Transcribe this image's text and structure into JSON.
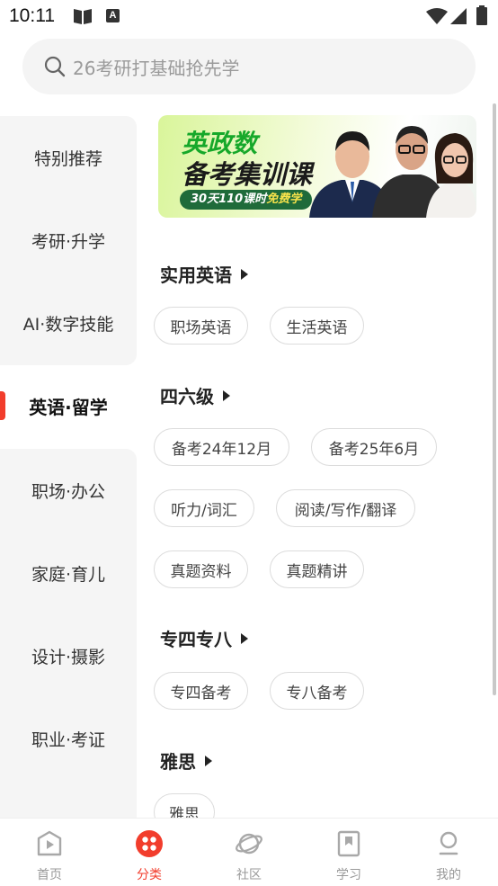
{
  "status_bar": {
    "time": "10:11",
    "icons": [
      "book-icon",
      "a-icon",
      "wifi-icon",
      "signal-icon",
      "battery-icon"
    ]
  },
  "search": {
    "placeholder": "26考研打基础抢先学"
  },
  "sidebar": {
    "items": [
      {
        "label": "特别推荐"
      },
      {
        "label": "考研·升学"
      },
      {
        "label": "AI·数字技能"
      },
      {
        "label": "英语·留学",
        "active": true
      },
      {
        "label": "职场·办公"
      },
      {
        "label": "家庭·育儿"
      },
      {
        "label": "设计·摄影"
      },
      {
        "label": "职业·考证"
      }
    ]
  },
  "banner": {
    "title_line1": "英政数",
    "title_line2": "备考集训课",
    "tag_main": "30天110课时",
    "tag_em": "免费学"
  },
  "sections": [
    {
      "title": "实用英语",
      "chips": [
        "职场英语",
        "生活英语"
      ]
    },
    {
      "title": "四六级",
      "chips": [
        "备考24年12月",
        "备考25年6月",
        "听力/词汇",
        "阅读/写作/翻译",
        "真题资料",
        "真题精讲"
      ]
    },
    {
      "title": "专四专八",
      "chips": [
        "专四备考",
        "专八备考"
      ]
    },
    {
      "title": "雅思",
      "chips": [
        "雅思"
      ]
    }
  ],
  "bottom_nav": [
    {
      "label": "首页",
      "icon": "home-play-icon"
    },
    {
      "label": "分类",
      "icon": "category-icon",
      "active": true
    },
    {
      "label": "社区",
      "icon": "planet-icon"
    },
    {
      "label": "学习",
      "icon": "bookmark-icon"
    },
    {
      "label": "我的",
      "icon": "profile-icon"
    }
  ],
  "colors": {
    "accent": "#f23d2c",
    "banner_green": "#16a82a",
    "tag_bg": "#1f6b3a"
  }
}
